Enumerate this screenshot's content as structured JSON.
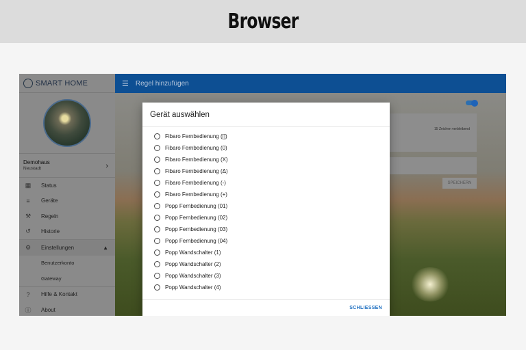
{
  "banner": {
    "title": "Browser"
  },
  "sidebar": {
    "brand": "SMART HOME",
    "user": {
      "name": "Demohaus",
      "location": "Neustadt"
    },
    "items": [
      {
        "label": "Status",
        "icon": "dashboard-icon"
      },
      {
        "label": "Geräte",
        "icon": "list-icon"
      },
      {
        "label": "Regeln",
        "icon": "wand-icon"
      },
      {
        "label": "Historie",
        "icon": "history-icon"
      },
      {
        "label": "Einstellungen",
        "icon": "gear-icon"
      }
    ],
    "subitems": [
      "Benutzerkonto",
      "Gateway"
    ],
    "footer": [
      {
        "label": "Hilfe & Kontakt",
        "icon": "help-icon"
      },
      {
        "label": "About",
        "icon": "info-icon"
      }
    ]
  },
  "header": {
    "title": "Regel hinzufügen"
  },
  "form": {
    "char_hint": "15 Zeichen verbleibend",
    "save_label": "SPEICHERN"
  },
  "dialog": {
    "title": "Gerät auswählen",
    "options": [
      "Fibaro Fernbedienung ([])",
      "Fibaro Fernbedienung (0)",
      "Fibaro Fernbedienung (X)",
      "Fibaro Fernbedienung (Δ)",
      "Fibaro Fernbedienung (-)",
      "Fibaro Fernbedienung (+)",
      "Popp Fernbedienung (01)",
      "Popp Fernbedienung (02)",
      "Popp Fernbedienung (03)",
      "Popp Fernbedienung (04)",
      "Popp Wandschalter (1)",
      "Popp Wandschalter (2)",
      "Popp Wandschalter (3)",
      "Popp Wandschalter (4)"
    ],
    "close_label": "SCHLIESSEN"
  },
  "colors": {
    "accent": "#0d4f93",
    "link": "#1e6fc1"
  }
}
